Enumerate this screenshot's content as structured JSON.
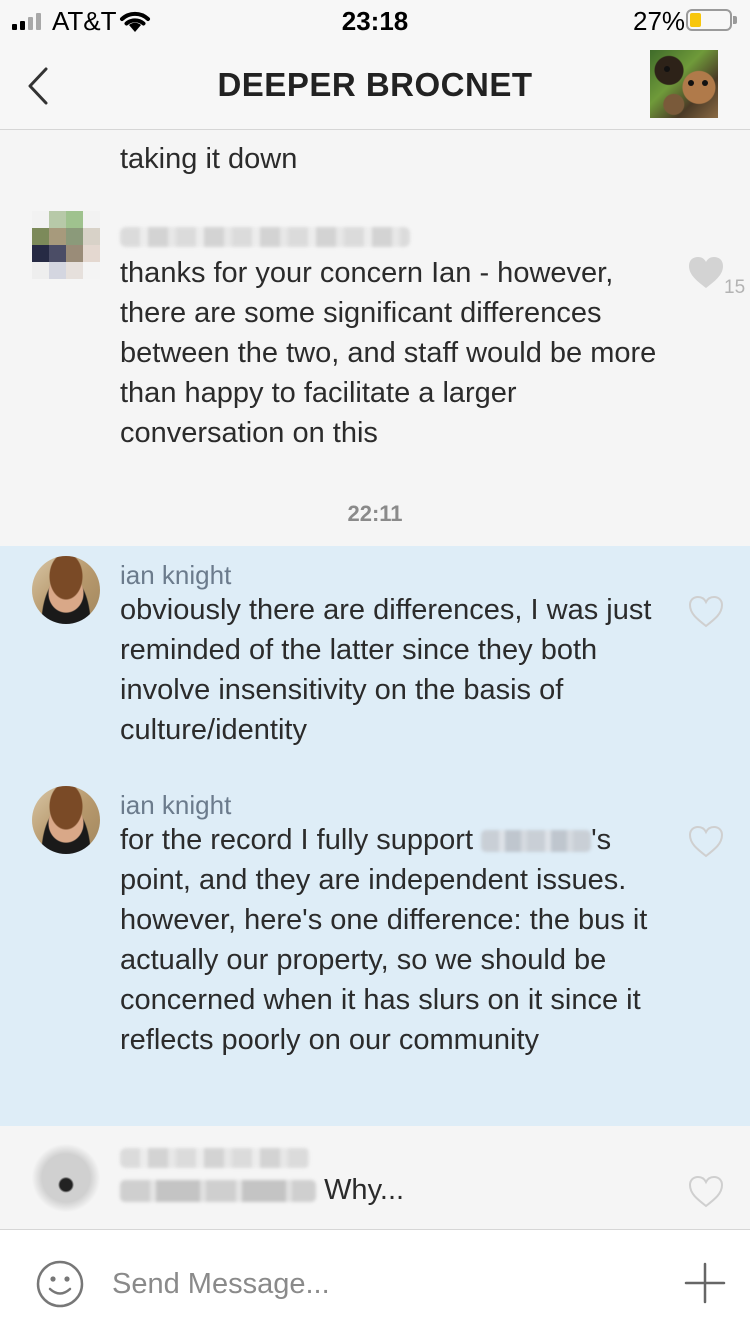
{
  "status_bar": {
    "carrier": "AT&T",
    "time": "23:18",
    "battery_percent": "27%",
    "battery_level": 0.27,
    "signal_bars": 2
  },
  "nav": {
    "title": "DEEPER BROCNET",
    "back_icon": "chevron-left-icon",
    "group_avatar": "dog-photo-avatar"
  },
  "messages": {
    "partial": {
      "text": "taking it down"
    },
    "staff": {
      "text": "thanks for your concern Ian - however, there are some significant differences between the two, and staff would be more than happy to facilitate a larger conversation on this",
      "likes": "15",
      "liked": true
    },
    "divider_time": "22:11",
    "ian1": {
      "author": "ian knight",
      "text": "obviously there are differences, I was just reminded of the latter since they both involve insensitivity on the basis of culture/identity"
    },
    "ian2": {
      "author": "ian knight",
      "text_before": "for the record I fully support ",
      "text_after": "'s",
      "text_rest": "point, and they are independent issues. however, here's one difference: the bus it actually our property, so we should be concerned when it has slurs on it since it reflects poorly on our community"
    },
    "last": {
      "text": "Why..."
    }
  },
  "input": {
    "placeholder": "Send Message...",
    "value": "",
    "emoji_icon": "smiley-icon",
    "plus_icon": "plus-icon"
  },
  "colors": {
    "highlight": "#deedf7",
    "author": "#6b7b8c",
    "battery": "#f7c60b"
  }
}
